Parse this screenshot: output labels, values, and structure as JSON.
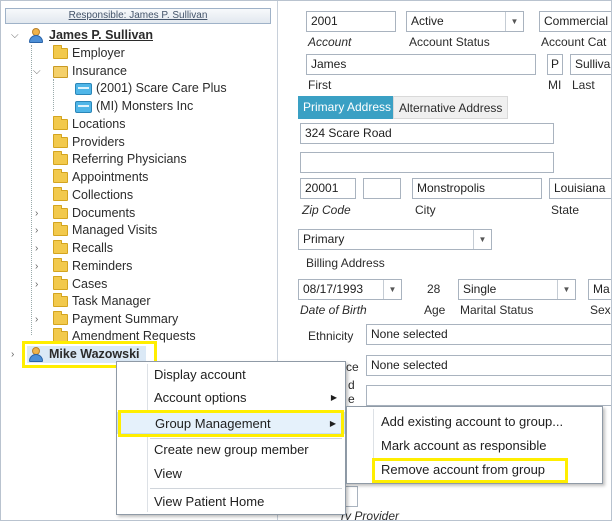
{
  "tree": {
    "responsible_bar": "Responsible: James P. Sullivan",
    "root_account": "James P. Sullivan",
    "items": [
      {
        "label": "Employer",
        "icon": "folder-icon"
      },
      {
        "label": "Insurance",
        "icon": "insurance-icon"
      },
      {
        "label": "(2001) Scare Care Plus",
        "icon": "insurance-card-icon"
      },
      {
        "label": "(MI) Monsters Inc",
        "icon": "insurance-card-icon"
      },
      {
        "label": "Locations",
        "icon": "folder-icon"
      },
      {
        "label": "Providers",
        "icon": "folder-icon"
      },
      {
        "label": "Referring Physicians",
        "icon": "folder-icon"
      },
      {
        "label": "Appointments",
        "icon": "folder-icon"
      },
      {
        "label": "Collections",
        "icon": "folder-icon"
      },
      {
        "label": "Documents",
        "icon": "folder-icon"
      },
      {
        "label": "Managed Visits",
        "icon": "folder-icon"
      },
      {
        "label": "Recalls",
        "icon": "folder-icon"
      },
      {
        "label": "Reminders",
        "icon": "folder-icon"
      },
      {
        "label": "Cases",
        "icon": "folder-icon"
      },
      {
        "label": "Task Manager",
        "icon": "folder-icon"
      },
      {
        "label": "Payment Summary",
        "icon": "folder-icon"
      },
      {
        "label": "Amendment Requests",
        "icon": "folder-icon"
      }
    ],
    "second_account": "Mike Wazowski",
    "highlight_color": "#ffee00"
  },
  "form": {
    "account_value": "2001",
    "account_label": "Account",
    "status_value": "Active",
    "status_label": "Account Status",
    "category_value": "Commercial I",
    "category_label": "Account Cat",
    "first_value": "James",
    "first_label": "First",
    "mi_value": "P",
    "mi_label": "MI",
    "last_value": "Sullivan",
    "last_label": "Last",
    "tab_primary": "Primary Address",
    "tab_alternative": "Alternative Address",
    "address1": "324 Scare Road",
    "address2": "",
    "zip_value": "20001",
    "zip_ext": "",
    "zip_label": "Zip Code",
    "city_value": "Monstropolis",
    "city_label": "City",
    "state_value": "Louisiana",
    "state_label": "State",
    "address_type_value": "Primary",
    "billing_label": "Billing Address",
    "dob_value": "08/17/1993",
    "dob_label": "Date of Birth",
    "age_value": "28",
    "age_label": "Age",
    "marital_value": "Single",
    "marital_label": "Marital Status",
    "sex_value": "Ma",
    "sex_label": "Sex",
    "ethnicity_label": "Ethnicity",
    "ethnicity_value": "None selected",
    "race_label_partial": "ce",
    "race_value": "None selected",
    "lang_label_partial_1": "d",
    "lang_label_partial_2": "e",
    "bottom_partial_label": "ry Provider",
    "tab_color": "#3aa0c4"
  },
  "context_menu": {
    "items": [
      {
        "label": "Display account",
        "has_submenu": false
      },
      {
        "label": "Account options",
        "has_submenu": true
      },
      {
        "label": "Group Management",
        "has_submenu": true
      },
      {
        "label": "Create new group member",
        "has_submenu": false
      },
      {
        "label": "View",
        "has_submenu": false
      },
      {
        "label": "View Patient Home",
        "has_submenu": false
      }
    ]
  },
  "submenu": {
    "items": [
      {
        "label": "Add existing account to group..."
      },
      {
        "label": "Mark account as responsible"
      },
      {
        "label": "Remove account from group"
      }
    ]
  }
}
